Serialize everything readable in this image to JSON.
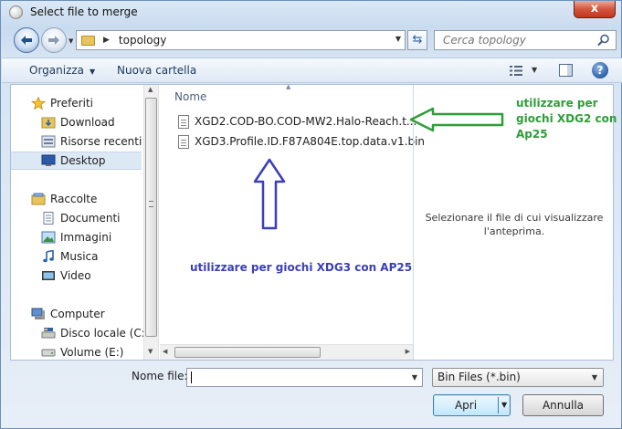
{
  "window": {
    "title": "Select file to merge",
    "close_glyph": "x"
  },
  "navbar": {
    "breadcrumb": "topology",
    "search_placeholder": "Cerca topology"
  },
  "toolbar": {
    "organize_label": "Organizza",
    "new_folder_label": "Nuova cartella",
    "help_glyph": "?"
  },
  "nav_pane": {
    "items": [
      {
        "label": "Preferiti",
        "icon": "star-icon"
      },
      {
        "label": "Download",
        "icon": "download-folder-icon"
      },
      {
        "label": "Risorse recenti",
        "icon": "recent-places-icon"
      },
      {
        "label": "Desktop",
        "icon": "desktop-icon",
        "selected": true
      },
      {
        "label": "Raccolte",
        "icon": "libraries-icon"
      },
      {
        "label": "Documenti",
        "icon": "documents-icon"
      },
      {
        "label": "Immagini",
        "icon": "pictures-icon"
      },
      {
        "label": "Musica",
        "icon": "music-icon"
      },
      {
        "label": "Video",
        "icon": "video-icon"
      },
      {
        "label": "Computer",
        "icon": "computer-icon"
      },
      {
        "label": "Disco locale (C:)",
        "icon": "local-disk-icon"
      },
      {
        "label": "Volume (E:)",
        "icon": "drive-icon"
      }
    ]
  },
  "file_list": {
    "column_name": "Nome",
    "files": [
      {
        "name": "XGD2.COD-BO.COD-MW2.Halo-Reach.t..."
      },
      {
        "name": "XGD3.Profile.ID.F87A804E.top.data.v1.bin"
      }
    ]
  },
  "preview": {
    "message_line1": "Selezionare il file di cui visualizzare",
    "message_line2": "l'anteprima."
  },
  "annotations": {
    "green_line1": "utilizzare per",
    "green_line2": "giochi XDG2 con",
    "green_line3": "Ap25",
    "blue_text": "utilizzare per giochi XDG3 con AP25",
    "green_color": "#2e9e3a",
    "blue_color": "#3b3fb8"
  },
  "bottom": {
    "filename_label": "Nome file:",
    "filename_value": "",
    "filetype_value": "Bin Files (*.bin)",
    "open_label": "Apri",
    "cancel_label": "Annulla"
  }
}
